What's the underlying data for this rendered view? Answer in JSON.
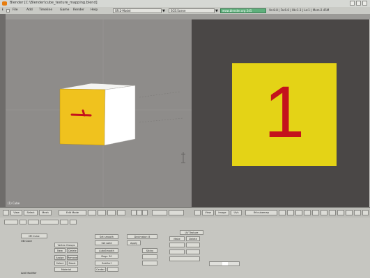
{
  "window": {
    "title": "Blender [C:\\Blender\\cube_texture_mapping.blend]",
    "colors": {
      "viewport_bg": "#8e8c8a",
      "image_editor_bg": "#4a4746",
      "face_yellow": "#f0c21e",
      "image_yellow": "#e4d316",
      "digit_red": "#c4121c",
      "status_green": "#5fb07c"
    }
  },
  "menubar": {
    "logo": "i",
    "items": [
      "File",
      "Add",
      "Timeline",
      "Game",
      "Render",
      "Help"
    ],
    "screen_selector": "SR:2-Model",
    "scene_selector": "SCE:Scene",
    "render_status": "www.blender.org 245",
    "stats": "Ve:8-8 | Fa:6-6 | Ob:1-3 | La:1 | Mem:2.45M"
  },
  "viewport3d": {
    "overlay_label": "(1) Cube",
    "cube_face_mark": "1",
    "menus": [
      "View",
      "Select",
      "Mode",
      "Edit Mode"
    ]
  },
  "image_editor": {
    "image_digit": "1"
  },
  "bottom_header": {
    "left_buttons": [
      "View",
      "Select",
      "Mesh"
    ],
    "mode": "Edit Mode",
    "right_buttons": [
      "View",
      "Image",
      "UVs"
    ],
    "image_name": "IM:cubemap"
  },
  "properties_panel": {
    "tabs": [
      "Link and Materials",
      "Mesh",
      "Multires",
      "Texture Face"
    ],
    "labels": [
      "ME:Cube",
      "OB:Cube",
      "Vertex Groups",
      "New",
      "Delete",
      "Assign",
      "Remove",
      "Select",
      "Desel.",
      "Material",
      "Set smooth",
      "Set solid",
      "AutoSmooth",
      "Degr: 30",
      "SubSurf",
      "Center",
      "Decimator: 8",
      "Apply",
      "Sticky",
      "UV Texture",
      "Make",
      "Delete"
    ],
    "footer_note": "Add Modifier"
  }
}
